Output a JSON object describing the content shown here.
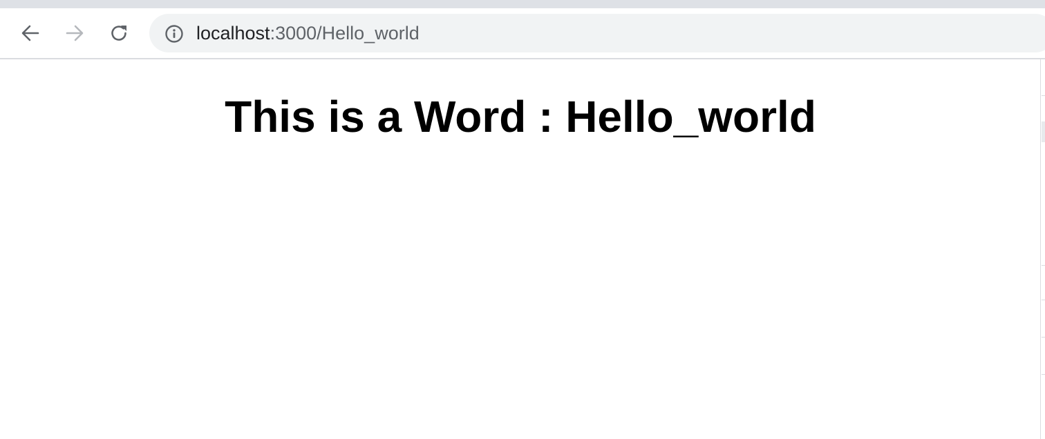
{
  "browser": {
    "toolbar": {
      "back_icon": "arrow-left-icon",
      "forward_icon": "arrow-right-icon",
      "reload_icon": "reload-icon"
    },
    "address_bar": {
      "security_icon": "info-icon",
      "url_host": "localhost",
      "url_rest": ":3000/Hello_world"
    }
  },
  "page": {
    "heading": "This is a Word : Hello_world"
  }
}
